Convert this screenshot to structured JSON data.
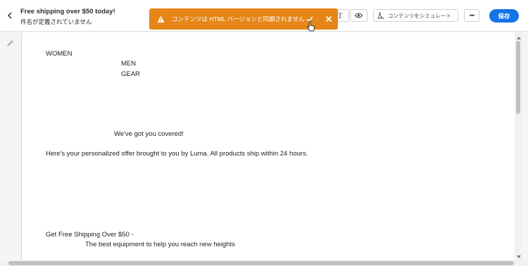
{
  "header": {
    "title": "Free shipping over $50 today!",
    "subtitle": "件名が定義されていません",
    "toolbar": {
      "text_mode_label": "T",
      "more_label": "•••",
      "simulate_label": "コンテンツをシミュレート",
      "save_label": "保存"
    }
  },
  "toast": {
    "message": "コンテンツは HTML バージョンと同期されません"
  },
  "canvas": {
    "nav": [
      "WOMEN",
      "MEN",
      "GEAR"
    ],
    "heading": "We've got you covered!",
    "body": "Here's your personalized offer brought to you by Luma. All products ship within 24 hours.",
    "promo_title": "Get Free Shipping Over $50 -",
    "promo_sub": "The best equipment to help you reach new heights"
  },
  "colors": {
    "accent": "#1473e6",
    "toast": "#e68619"
  },
  "icons": [
    "back-chevron-icon",
    "preview-eye-icon",
    "simulate-icon",
    "warning-icon",
    "check-icon",
    "close-icon",
    "pointer-cursor-icon",
    "pencil-icon"
  ]
}
